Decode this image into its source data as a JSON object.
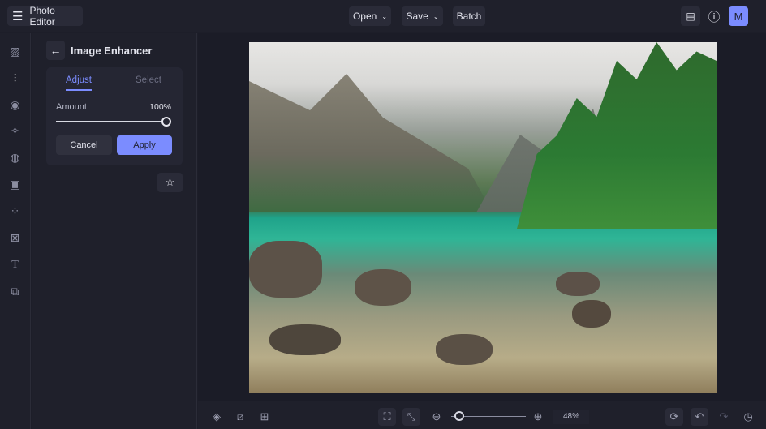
{
  "header": {
    "app_title": "Photo Editor",
    "open_label": "Open",
    "save_label": "Save",
    "batch_label": "Batch",
    "avatar_initial": "M"
  },
  "panel": {
    "title": "Image Enhancer",
    "tabs": [
      {
        "label": "Adjust",
        "active": true
      },
      {
        "label": "Select",
        "active": false
      }
    ],
    "amount_label": "Amount",
    "amount_value": "100%",
    "amount_fraction": 1.0,
    "cancel_label": "Cancel",
    "apply_label": "Apply"
  },
  "zoom": {
    "value": "48%",
    "fraction": 0.05
  },
  "colors": {
    "accent": "#7b8cff",
    "background": "#1d1e29"
  }
}
